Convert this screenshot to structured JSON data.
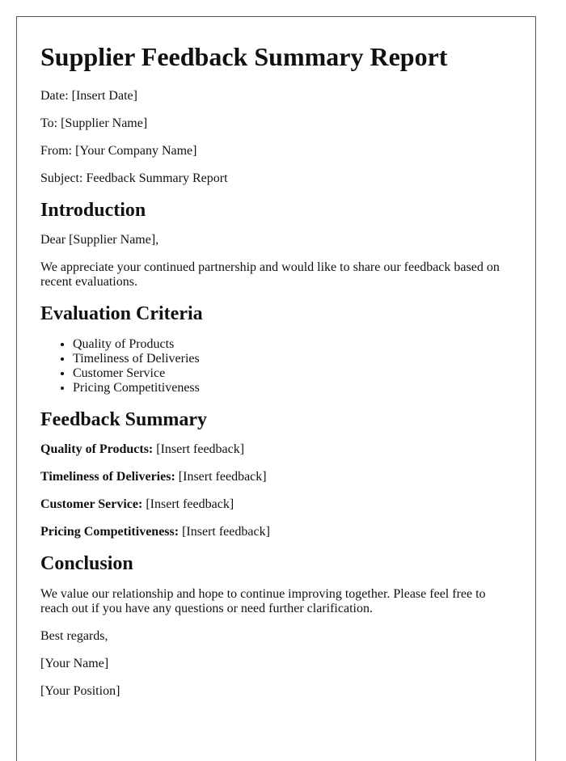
{
  "title": "Supplier Feedback Summary Report",
  "meta": [
    "Date: [Insert Date]",
    "To: [Supplier Name]",
    "From: [Your Company Name]",
    "Subject: Feedback Summary Report"
  ],
  "introduction": {
    "heading": "Introduction",
    "greeting": "Dear [Supplier Name],",
    "body": "We appreciate your continued partnership and would like to share our feedback based on recent evaluations."
  },
  "criteria": {
    "heading": "Evaluation Criteria",
    "items": [
      "Quality of Products",
      "Timeliness of Deliveries",
      "Customer Service",
      "Pricing Competitiveness"
    ]
  },
  "feedback": {
    "heading": "Feedback Summary",
    "items": [
      {
        "label": "Quality of Products:",
        "value": " [Insert feedback]"
      },
      {
        "label": "Timeliness of Deliveries:",
        "value": " [Insert feedback]"
      },
      {
        "label": "Customer Service:",
        "value": " [Insert feedback]"
      },
      {
        "label": "Pricing Competitiveness:",
        "value": " [Insert feedback]"
      }
    ]
  },
  "conclusion": {
    "heading": "Conclusion",
    "body": "We value our relationship and hope to continue improving together. Please feel free to reach out if you have any questions or need further clarification.",
    "closing": "Best regards,",
    "name": "[Your Name]",
    "position": "[Your Position]"
  }
}
